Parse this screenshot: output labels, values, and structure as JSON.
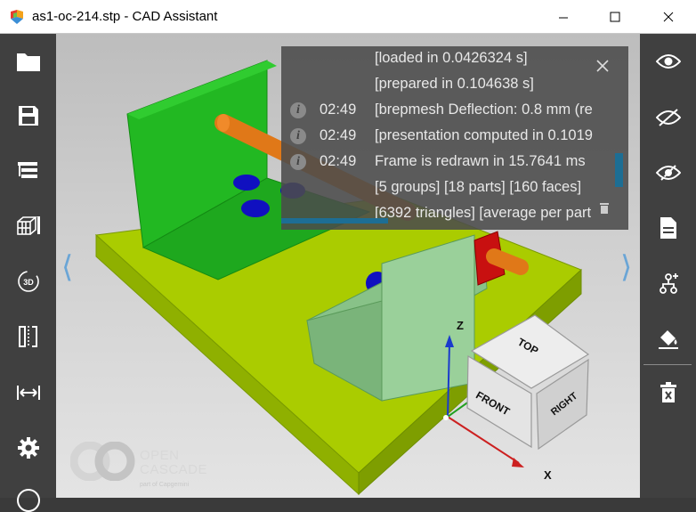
{
  "window": {
    "title": "as1-oc-214.stp - CAD Assistant"
  },
  "left_toolbar": [
    {
      "name": "open-file-icon"
    },
    {
      "name": "save-icon"
    },
    {
      "name": "model-tree-icon"
    },
    {
      "name": "explode-icon"
    },
    {
      "name": "view-3d-icon"
    },
    {
      "name": "section-clip-icon"
    },
    {
      "name": "measure-icon"
    },
    {
      "name": "settings-icon"
    }
  ],
  "right_toolbar": [
    {
      "name": "show-icon"
    },
    {
      "name": "hide-icon"
    },
    {
      "name": "isolate-icon"
    },
    {
      "name": "document-info-icon"
    },
    {
      "name": "hierarchy-icon"
    },
    {
      "name": "paint-bucket-icon"
    },
    {
      "name": "delete-icon"
    }
  ],
  "log": {
    "entries": [
      {
        "time": "",
        "text": "[loaded in 0.0426324 s]",
        "icon": false
      },
      {
        "time": "",
        "text": "[prepared in 0.104638 s]",
        "icon": false
      },
      {
        "time": "02:49",
        "text": "[brepmesh Deflection:  0.8 mm (re",
        "icon": true
      },
      {
        "time": "02:49",
        "text": "[presentation computed in 0.1019",
        "icon": true
      },
      {
        "time": "02:49",
        "text": "Frame is redrawn in 15.7641 ms",
        "icon": true
      },
      {
        "time": "",
        "text": "[5 groups] [18 parts] [160 faces]",
        "icon": false
      },
      {
        "time": "",
        "text": "[6392 triangles] [average per part",
        "icon": false
      }
    ]
  },
  "view_cube": {
    "top": "TOP",
    "front": "FRONT",
    "right": "RIGHT"
  },
  "axes": {
    "z": "Z",
    "x": "X"
  },
  "logo": {
    "line1": "OPEN",
    "line2": "CASCADE",
    "sub": "part of Capgemini"
  },
  "colors": {
    "base_plate": "#aacc00",
    "bracket": "#22b822",
    "support": "#88c288",
    "rod": "#e07818",
    "holes": "#1010c0",
    "flange": "#c81010",
    "accent": "#1d6e94"
  }
}
